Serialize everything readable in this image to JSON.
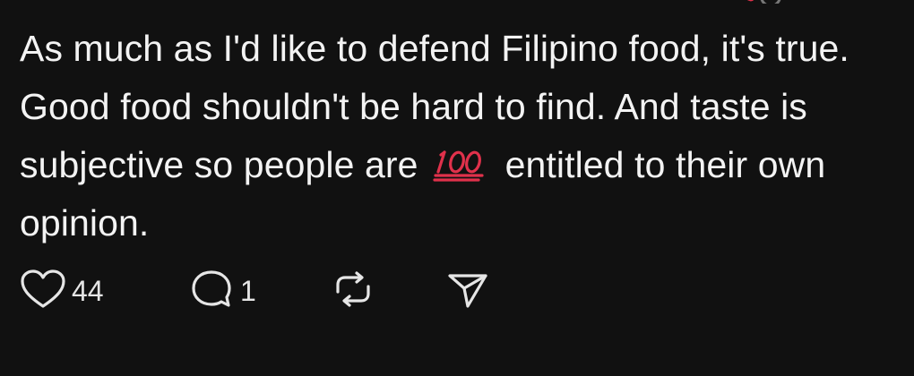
{
  "post": {
    "text_before_emoji": "As much as I'd like to defend Filipino food, it's true. Good food shouldn't be hard to find. And taste is subjective so people are",
    "emoji": "hundred-points-emoji",
    "text_after_emoji": "entitled to their own opinion."
  },
  "actions": {
    "like": {
      "icon": "heart-icon",
      "count": "44"
    },
    "reply": {
      "icon": "comment-bubble-icon",
      "count": "1"
    },
    "repost": {
      "icon": "repost-icon"
    },
    "share": {
      "icon": "send-icon"
    }
  },
  "colors": {
    "background": "#111111",
    "text": "#f3f3f3",
    "emoji_red": "#e0314b"
  }
}
